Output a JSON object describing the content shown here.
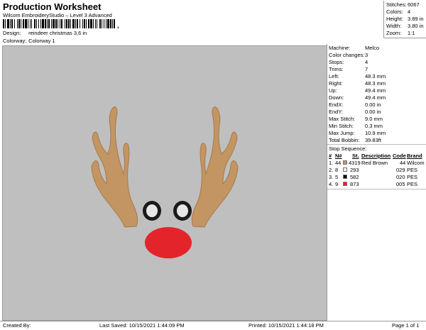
{
  "header": {
    "title": "Production Worksheet",
    "subtitle": "Wilcom EmbroideryStudio – Level 3 Advanced",
    "barcode_comma": ",",
    "design_label": "Design:",
    "design_value": "reindeer christmas 3,6 in",
    "colorway_label": "Colorway:",
    "colorway_value": "Colorway 1"
  },
  "stats": [
    {
      "label": "Stitches:",
      "value": "6067"
    },
    {
      "label": "Colors:",
      "value": "4"
    },
    {
      "label": "Height:",
      "value": "3.89 in"
    },
    {
      "label": "Width:",
      "value": "3.80 in"
    },
    {
      "label": "Zoom:",
      "value": "1:1"
    }
  ],
  "machine_info": [
    {
      "label": "Machine:",
      "value": "Melco"
    },
    {
      "label": "Color changes:",
      "value": "3"
    },
    {
      "label": "Stops:",
      "value": "4"
    },
    {
      "label": "Trims:",
      "value": "7"
    },
    {
      "label": "Left:",
      "value": "48.3 mm"
    },
    {
      "label": "Right:",
      "value": "48.3 mm"
    },
    {
      "label": "Up:",
      "value": "49.4 mm"
    },
    {
      "label": "Down:",
      "value": "49.4 mm"
    },
    {
      "label": "EndX:",
      "value": "0.00 in"
    },
    {
      "label": "EndY:",
      "value": "0.00 in"
    },
    {
      "label": "Max Stitch:",
      "value": "9.0 mm"
    },
    {
      "label": "Min Stitch:",
      "value": "0.3 mm"
    },
    {
      "label": "Max Jump:",
      "value": "10.9 mm"
    },
    {
      "label": "Total Bobbin:",
      "value": "39.83ft"
    }
  ],
  "stop_sequence": {
    "title": "Stop Sequence:",
    "headers": {
      "num": "#",
      "n": "N#",
      "st": "St.",
      "desc": "Description",
      "code": "Code",
      "brand": "Brand"
    },
    "rows": [
      {
        "num": "1.",
        "n": "44",
        "color": "#c09464",
        "st": "4319",
        "desc": "Red Brown",
        "code": "44",
        "brand": "Wilcom"
      },
      {
        "num": "2.",
        "n": "8",
        "color": "#f2f2f2",
        "st": "293",
        "desc": "",
        "code": "029",
        "brand": "PES"
      },
      {
        "num": "3.",
        "n": "5",
        "color": "#000000",
        "st": "582",
        "desc": "",
        "code": "020",
        "brand": "PES"
      },
      {
        "num": "4.",
        "n": "9",
        "color": "#e8202a",
        "st": "873",
        "desc": "",
        "code": "005",
        "brand": "PES"
      }
    ]
  },
  "design_colors": {
    "antler": "#c39563",
    "antler_dark": "#a67a4a",
    "eye_ring": "#1a1a1a",
    "eye_white": "#e6e6e6",
    "nose": "#e3242b",
    "background": "#bfbfbf"
  },
  "footer": {
    "created": "Created By:",
    "saved": "Last Saved: 10/15/2021 1:44:09 PM",
    "printed": "Printed: 10/15/2021 1:44:18 PM",
    "page": "Page 1 of 1"
  }
}
